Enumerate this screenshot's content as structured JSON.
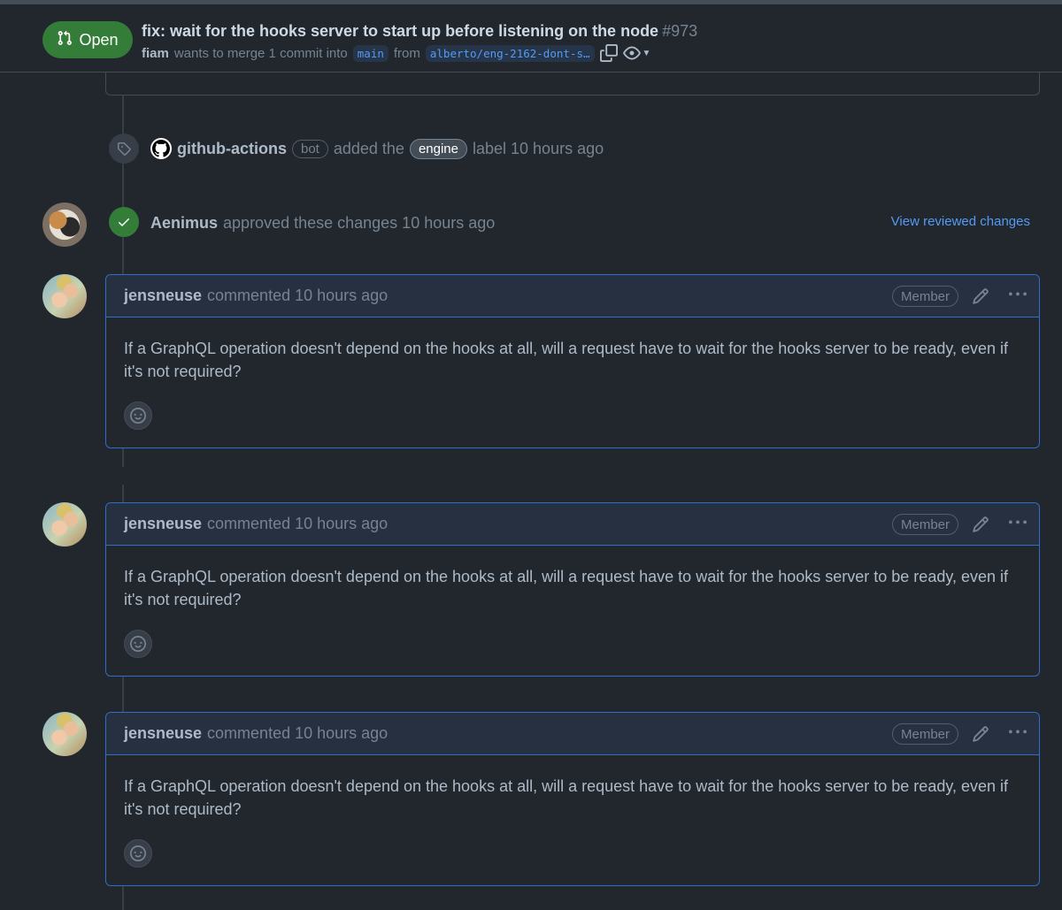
{
  "header": {
    "state": "Open",
    "title": "fix: wait for the hooks server to start up before listening on the node",
    "number": "#973",
    "author": "fiam",
    "merge_text": "wants to merge 1 commit into",
    "base_branch": "main",
    "from_text": "from",
    "head_branch": "alberto/eng-2162-dont-s…"
  },
  "timeline": {
    "label_event": {
      "actor": "github-actions",
      "badge": "bot",
      "action": "added the",
      "label": "engine",
      "suffix": "label 10 hours ago"
    },
    "approve_event": {
      "actor": "Aenimus",
      "action": "approved these changes 10 hours ago",
      "link": "View reviewed changes"
    }
  },
  "comments": [
    {
      "author": "jensneuse",
      "meta": "commented 10 hours ago",
      "badge": "Member",
      "body": "If a GraphQL operation doesn't depend on the hooks at all, will a request have to wait for the hooks server to be ready, even if it's not required?"
    },
    {
      "author": "jensneuse",
      "meta": "commented 10 hours ago",
      "badge": "Member",
      "body": "If a GraphQL operation doesn't depend on the hooks at all, will a request have to wait for the hooks server to be ready, even if it's not required?"
    },
    {
      "author": "jensneuse",
      "meta": "commented 10 hours ago",
      "badge": "Member",
      "body": "If a GraphQL operation doesn't depend on the hooks at all, will a request have to wait for the hooks server to be ready, even if it's not required?"
    }
  ],
  "colors": {
    "open_green": "#347d39",
    "link_blue": "#539bf5",
    "background": "#22272e"
  },
  "icons": [
    "git-pull-request-icon",
    "copy-icon",
    "eye-icon",
    "tag-icon",
    "github-mark-icon",
    "check-icon",
    "pencil-icon",
    "kebab-icon",
    "smiley-icon"
  ]
}
